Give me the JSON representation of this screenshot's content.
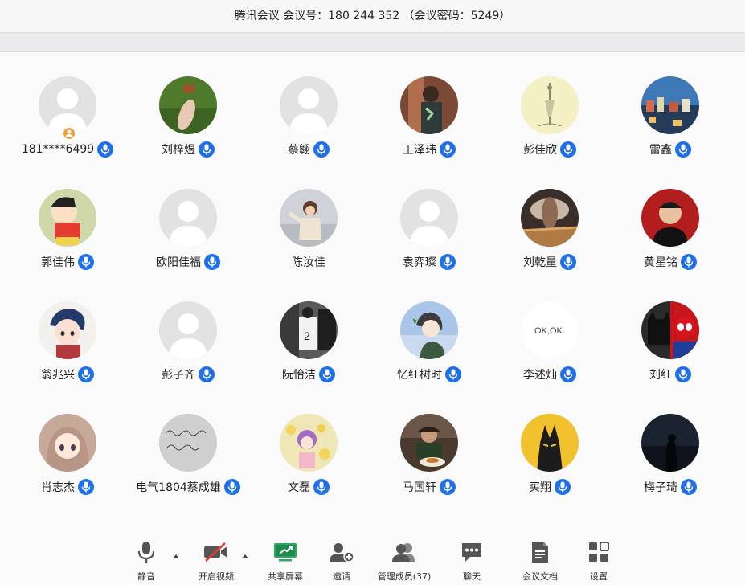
{
  "title": "腾讯会议 会议号：180 244 352 （会议密码：5249）",
  "participants": [
    {
      "name": "181****6499",
      "avatar": "default-silhouette-icon",
      "host": true,
      "mic": true
    },
    {
      "name": "刘梓煜",
      "avatar": "grass-feet-photo",
      "mic": true
    },
    {
      "name": "蔡翱",
      "avatar": "default-silhouette-icon",
      "mic": true
    },
    {
      "name": "王泽玮",
      "avatar": "person-photo",
      "mic": true
    },
    {
      "name": "彭佳欣",
      "avatar": "sketch-drawing",
      "mic": true
    },
    {
      "name": "雷鑫",
      "avatar": "city-night-photo",
      "mic": true
    },
    {
      "name": "郭佳伟",
      "avatar": "cartoon-boy",
      "mic": true
    },
    {
      "name": "欧阳佳福",
      "avatar": "default-silhouette-icon",
      "mic": true
    },
    {
      "name": "陈汝佳",
      "avatar": "child-photo",
      "mic": false
    },
    {
      "name": "袁弈璨",
      "avatar": "default-silhouette-icon",
      "mic": true
    },
    {
      "name": "刘乾量",
      "avatar": "explosion-photo",
      "mic": true
    },
    {
      "name": "黄星铭",
      "avatar": "portrait-photo",
      "mic": true
    },
    {
      "name": "翁兆兴",
      "avatar": "anime-boy",
      "mic": true
    },
    {
      "name": "彭子齐",
      "avatar": "default-silhouette-icon",
      "mic": true
    },
    {
      "name": "阮怡洁",
      "avatar": "basketball-photo",
      "mic": true
    },
    {
      "name": "忆红树时",
      "avatar": "anime-character",
      "mic": true
    },
    {
      "name": "李述灿",
      "avatar": "text-okok",
      "avatar_text": "OK,OK.",
      "mic": true
    },
    {
      "name": "刘红",
      "avatar": "batman-spiderman",
      "mic": true
    },
    {
      "name": "肖志杰",
      "avatar": "anime-girl",
      "mic": true
    },
    {
      "name": "电气1804蔡成雄",
      "avatar": "handwriting-photo",
      "mic": true
    },
    {
      "name": "文磊",
      "avatar": "flower-girl",
      "mic": true
    },
    {
      "name": "马国轩",
      "avatar": "dinner-photo",
      "mic": true
    },
    {
      "name": "买翔",
      "avatar": "yellow-wolf",
      "mic": true
    },
    {
      "name": "梅子琦",
      "avatar": "dark-silhouette",
      "mic": true
    }
  ],
  "toolbar": {
    "mute": {
      "label": "静音",
      "icon": "microphone-icon"
    },
    "video": {
      "label": "开启视频",
      "icon": "camera-off-icon"
    },
    "share": {
      "label": "共享屏幕",
      "icon": "share-screen-icon"
    },
    "invite": {
      "label": "邀请",
      "icon": "add-user-icon"
    },
    "manage": {
      "label": "管理成员(37)",
      "icon": "members-icon"
    },
    "chat": {
      "label": "聊天",
      "icon": "chat-icon"
    },
    "docs": {
      "label": "会议文档",
      "icon": "document-icon"
    },
    "settings": {
      "label": "设置",
      "icon": "settings-grid-icon"
    }
  },
  "colors": {
    "mic_badge": "#1e6fe8",
    "share_green": "#2aa760",
    "host_badge": "#f0a030",
    "video_off_red": "#e03c31"
  }
}
